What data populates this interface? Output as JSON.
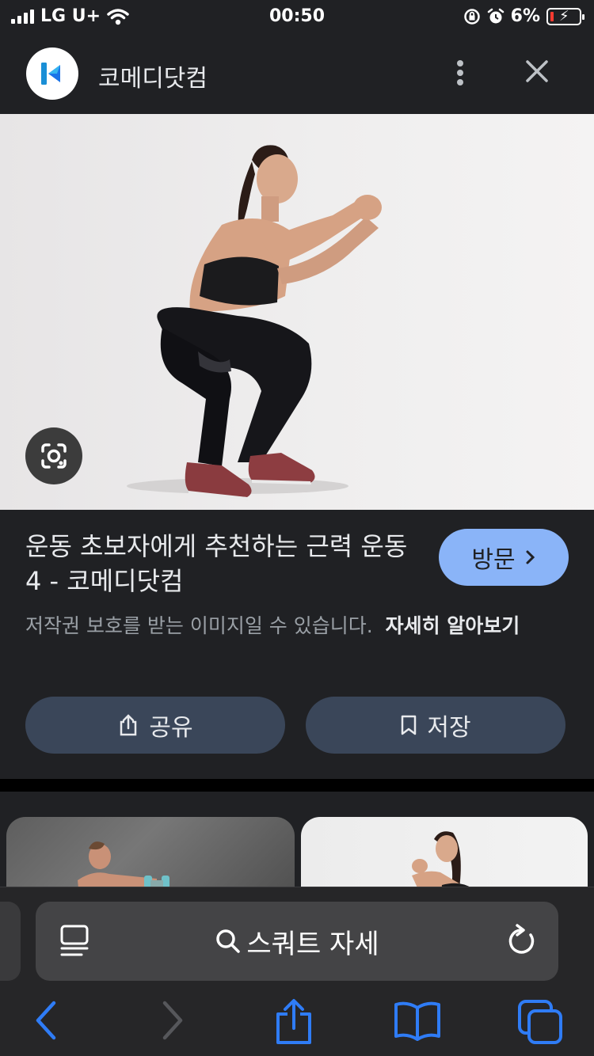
{
  "status": {
    "carrier": "LG U+",
    "time": "00:50",
    "battery": "6%",
    "battery_level": 0.06,
    "signal_bars": 4
  },
  "header": {
    "site_name": "코메디닷컴",
    "logo_icon": "kormedi-logo-icon",
    "more_icon": "more-vert-icon",
    "close_icon": "close-icon"
  },
  "image": {
    "lens_icon": "google-lens-icon"
  },
  "result": {
    "title": "운동 초보자에게 추천하는 근력 운동 4 - 코메디닷컴",
    "visit_label": "방문",
    "copyright_text": "저작권 보호를 받는 이미지일 수 있습니다.",
    "learn_more": "자세히 알아보기",
    "share_label": "공유",
    "save_label": "저장"
  },
  "browser": {
    "search_query": "스쿼트 자세",
    "accent": "#2f7cf6"
  },
  "colors": {
    "background": "#202124",
    "visit_button": "#8ab4f8",
    "action_button": "#3a4659"
  }
}
